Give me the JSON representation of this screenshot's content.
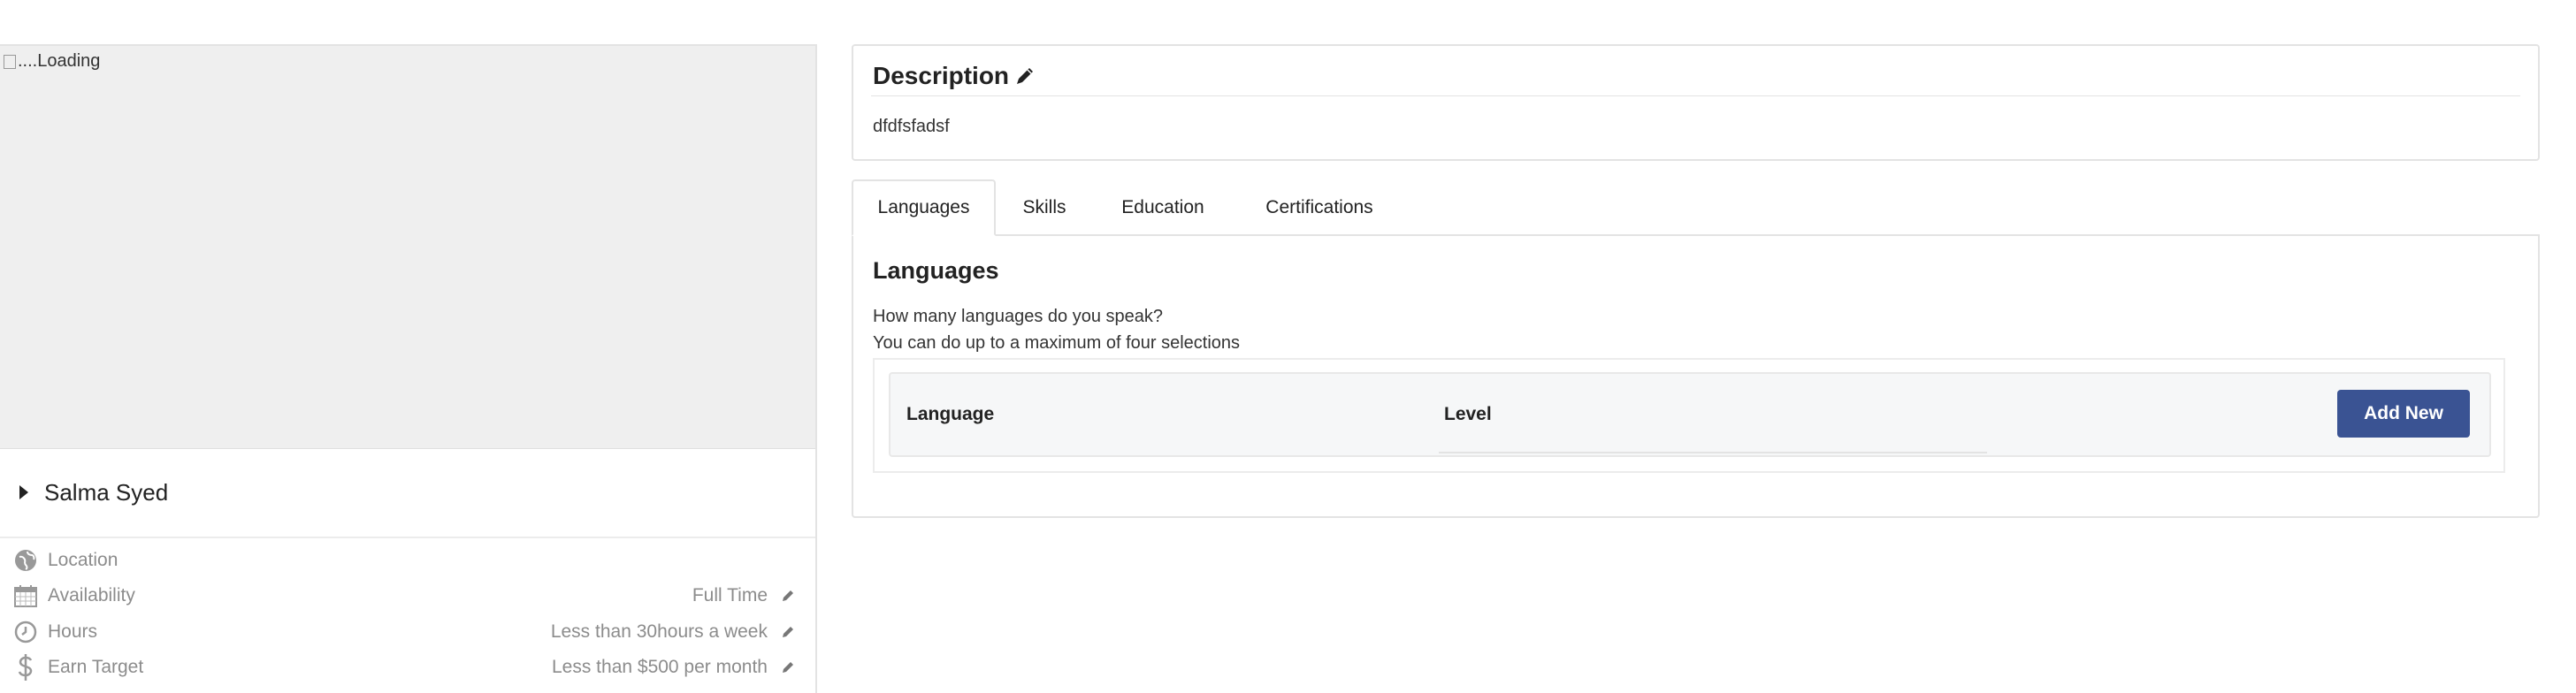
{
  "profile": {
    "photo_alt": "....Loading",
    "name": "Salma Syed",
    "info": [
      {
        "icon": "globe-icon",
        "label": "Location",
        "value": "",
        "editable": false
      },
      {
        "icon": "calendar-icon",
        "label": "Availability",
        "value": "Full Time",
        "editable": true
      },
      {
        "icon": "clock-icon",
        "label": "Hours",
        "value": "Less than 30hours a week",
        "editable": true
      },
      {
        "icon": "dollar-icon",
        "label": "Earn Target",
        "value": "Less than $500 per month",
        "editable": true
      }
    ]
  },
  "description": {
    "title": "Description",
    "text": "dfdfsfadsf"
  },
  "tabs": [
    {
      "label": "Languages",
      "active": true
    },
    {
      "label": "Skills",
      "active": false
    },
    {
      "label": "Education",
      "active": false
    },
    {
      "label": "Certifications",
      "active": false
    }
  ],
  "languages_panel": {
    "title": "Languages",
    "question": "How many languages do you speak?",
    "hint": "You can do up to a maximum of four selections",
    "columns": [
      "Language",
      "Level"
    ],
    "add_button": "Add New"
  },
  "colors": {
    "primary_button": "#3a5393",
    "muted_text": "#8c8c8c",
    "border": "#e3e3e3"
  }
}
